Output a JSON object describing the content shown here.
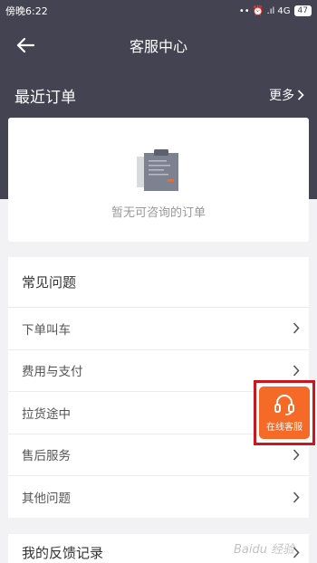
{
  "status_bar": {
    "time": "傍晚6:22",
    "indicators": "•• ⏰ .ıl 4G",
    "battery": "47"
  },
  "nav": {
    "title": "客服中心"
  },
  "recent_orders": {
    "title": "最近订单",
    "more_label": "更多",
    "empty_text": "暂无可咨询的订单"
  },
  "faq": {
    "title": "常见问题",
    "items": [
      {
        "label": "下单叫车"
      },
      {
        "label": "费用与支付"
      },
      {
        "label": "拉货途中"
      },
      {
        "label": "售后服务"
      },
      {
        "label": "其他问题"
      }
    ]
  },
  "feedback": {
    "label": "我的反馈记录"
  },
  "float_service": {
    "label": "在线客服"
  },
  "watermark": {
    "text": "Baidu 经验"
  },
  "colors": {
    "header_bg": "#444352",
    "accent": "#f56a27",
    "highlight_border": "#c8181e"
  }
}
